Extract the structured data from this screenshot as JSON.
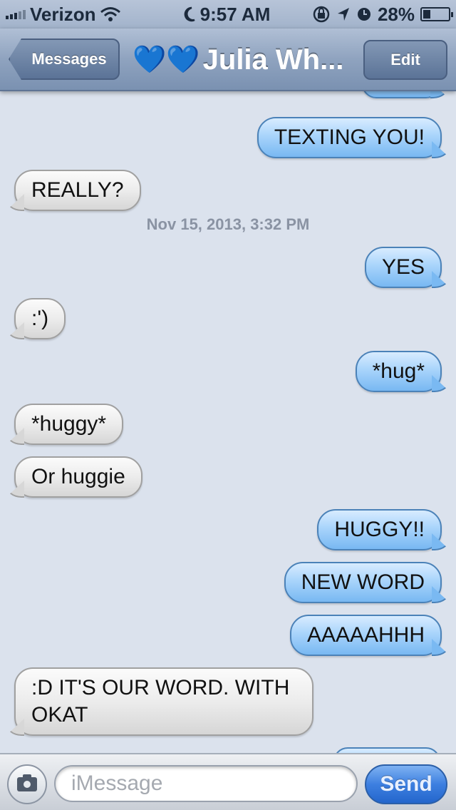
{
  "status_bar": {
    "carrier": "Verizon",
    "time": "9:57 AM",
    "battery": "28%",
    "battery_level": 0.28
  },
  "nav": {
    "back_label": "Messages",
    "hearts": "💙💙",
    "contact_name": "Julia Wh...",
    "edit_label": "Edit"
  },
  "conversation": {
    "timestamp": "Nov 15, 2013, 3:32 PM",
    "messages": [
      {
        "direction": "outgoing",
        "text": "TEXTING YOU!"
      },
      {
        "direction": "incoming",
        "text": "REALLY?"
      },
      {
        "direction": "outgoing",
        "text": "YES"
      },
      {
        "direction": "incoming",
        "text": ":')"
      },
      {
        "direction": "outgoing",
        "text": "*hug*"
      },
      {
        "direction": "incoming",
        "text": "*huggy*"
      },
      {
        "direction": "incoming",
        "text": "Or huggie"
      },
      {
        "direction": "outgoing",
        "text": "HUGGY!!"
      },
      {
        "direction": "outgoing",
        "text": "NEW WORD"
      },
      {
        "direction": "outgoing",
        "text": "AAAAAHHH"
      },
      {
        "direction": "incoming",
        "text": ":D IT'S OUR WORD. WITH OKAT"
      }
    ]
  },
  "input_bar": {
    "placeholder": "iMessage",
    "send_label": "Send"
  }
}
